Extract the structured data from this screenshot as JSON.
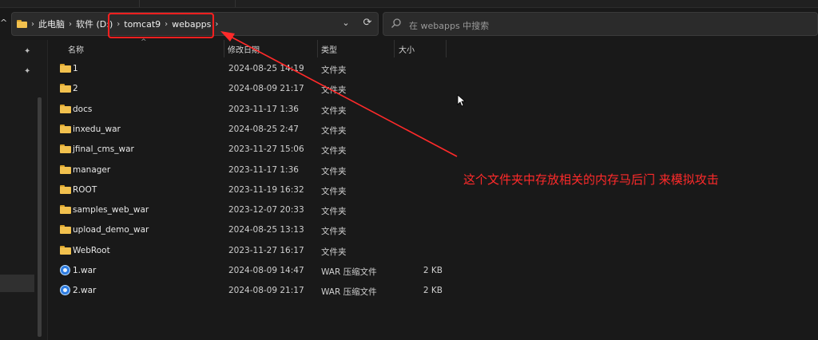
{
  "address": {
    "crumbs": [
      "此电脑",
      "软件 (D:)",
      "tomcat9",
      "webapps"
    ]
  },
  "search": {
    "placeholder": "在 webapps 中搜索"
  },
  "columns": {
    "name": "名称",
    "modified": "修改日期",
    "type": "类型",
    "size": "大小"
  },
  "rows": [
    {
      "name": "1",
      "modified": "2024-08-25 14:19",
      "type": "文件夹",
      "size": "",
      "icon": "folder-icon"
    },
    {
      "name": "2",
      "modified": "2024-08-09 21:17",
      "type": "文件夹",
      "size": "",
      "icon": "folder-icon"
    },
    {
      "name": "docs",
      "modified": "2023-11-17 1:36",
      "type": "文件夹",
      "size": "",
      "icon": "folder-icon"
    },
    {
      "name": "inxedu_war",
      "modified": "2024-08-25 2:47",
      "type": "文件夹",
      "size": "",
      "icon": "folder-icon"
    },
    {
      "name": "jfinal_cms_war",
      "modified": "2023-11-27 15:06",
      "type": "文件夹",
      "size": "",
      "icon": "folder-icon"
    },
    {
      "name": "manager",
      "modified": "2023-11-17 1:36",
      "type": "文件夹",
      "size": "",
      "icon": "folder-icon"
    },
    {
      "name": "ROOT",
      "modified": "2023-11-19 16:32",
      "type": "文件夹",
      "size": "",
      "icon": "folder-icon"
    },
    {
      "name": "samples_web_war",
      "modified": "2023-12-07 20:33",
      "type": "文件夹",
      "size": "",
      "icon": "folder-icon"
    },
    {
      "name": "upload_demo_war",
      "modified": "2024-08-25 13:13",
      "type": "文件夹",
      "size": "",
      "icon": "folder-icon"
    },
    {
      "name": "WebRoot",
      "modified": "2023-11-27 16:17",
      "type": "文件夹",
      "size": "",
      "icon": "folder-icon"
    },
    {
      "name": "1.war",
      "modified": "2024-08-09 14:47",
      "type": "WAR 压缩文件",
      "size": "2 KB",
      "icon": "war-file-icon"
    },
    {
      "name": "2.war",
      "modified": "2024-08-09 21:17",
      "type": "WAR 压缩文件",
      "size": "2 KB",
      "icon": "war-file-icon"
    }
  ],
  "annotation": {
    "text": "这个文件夹中存放相关的内存马后门 来模拟攻击",
    "color": "#ff2a2a"
  },
  "colors": {
    "highlight": "#ff1f1f",
    "folder": "#f2c14e",
    "background": "#191919"
  }
}
